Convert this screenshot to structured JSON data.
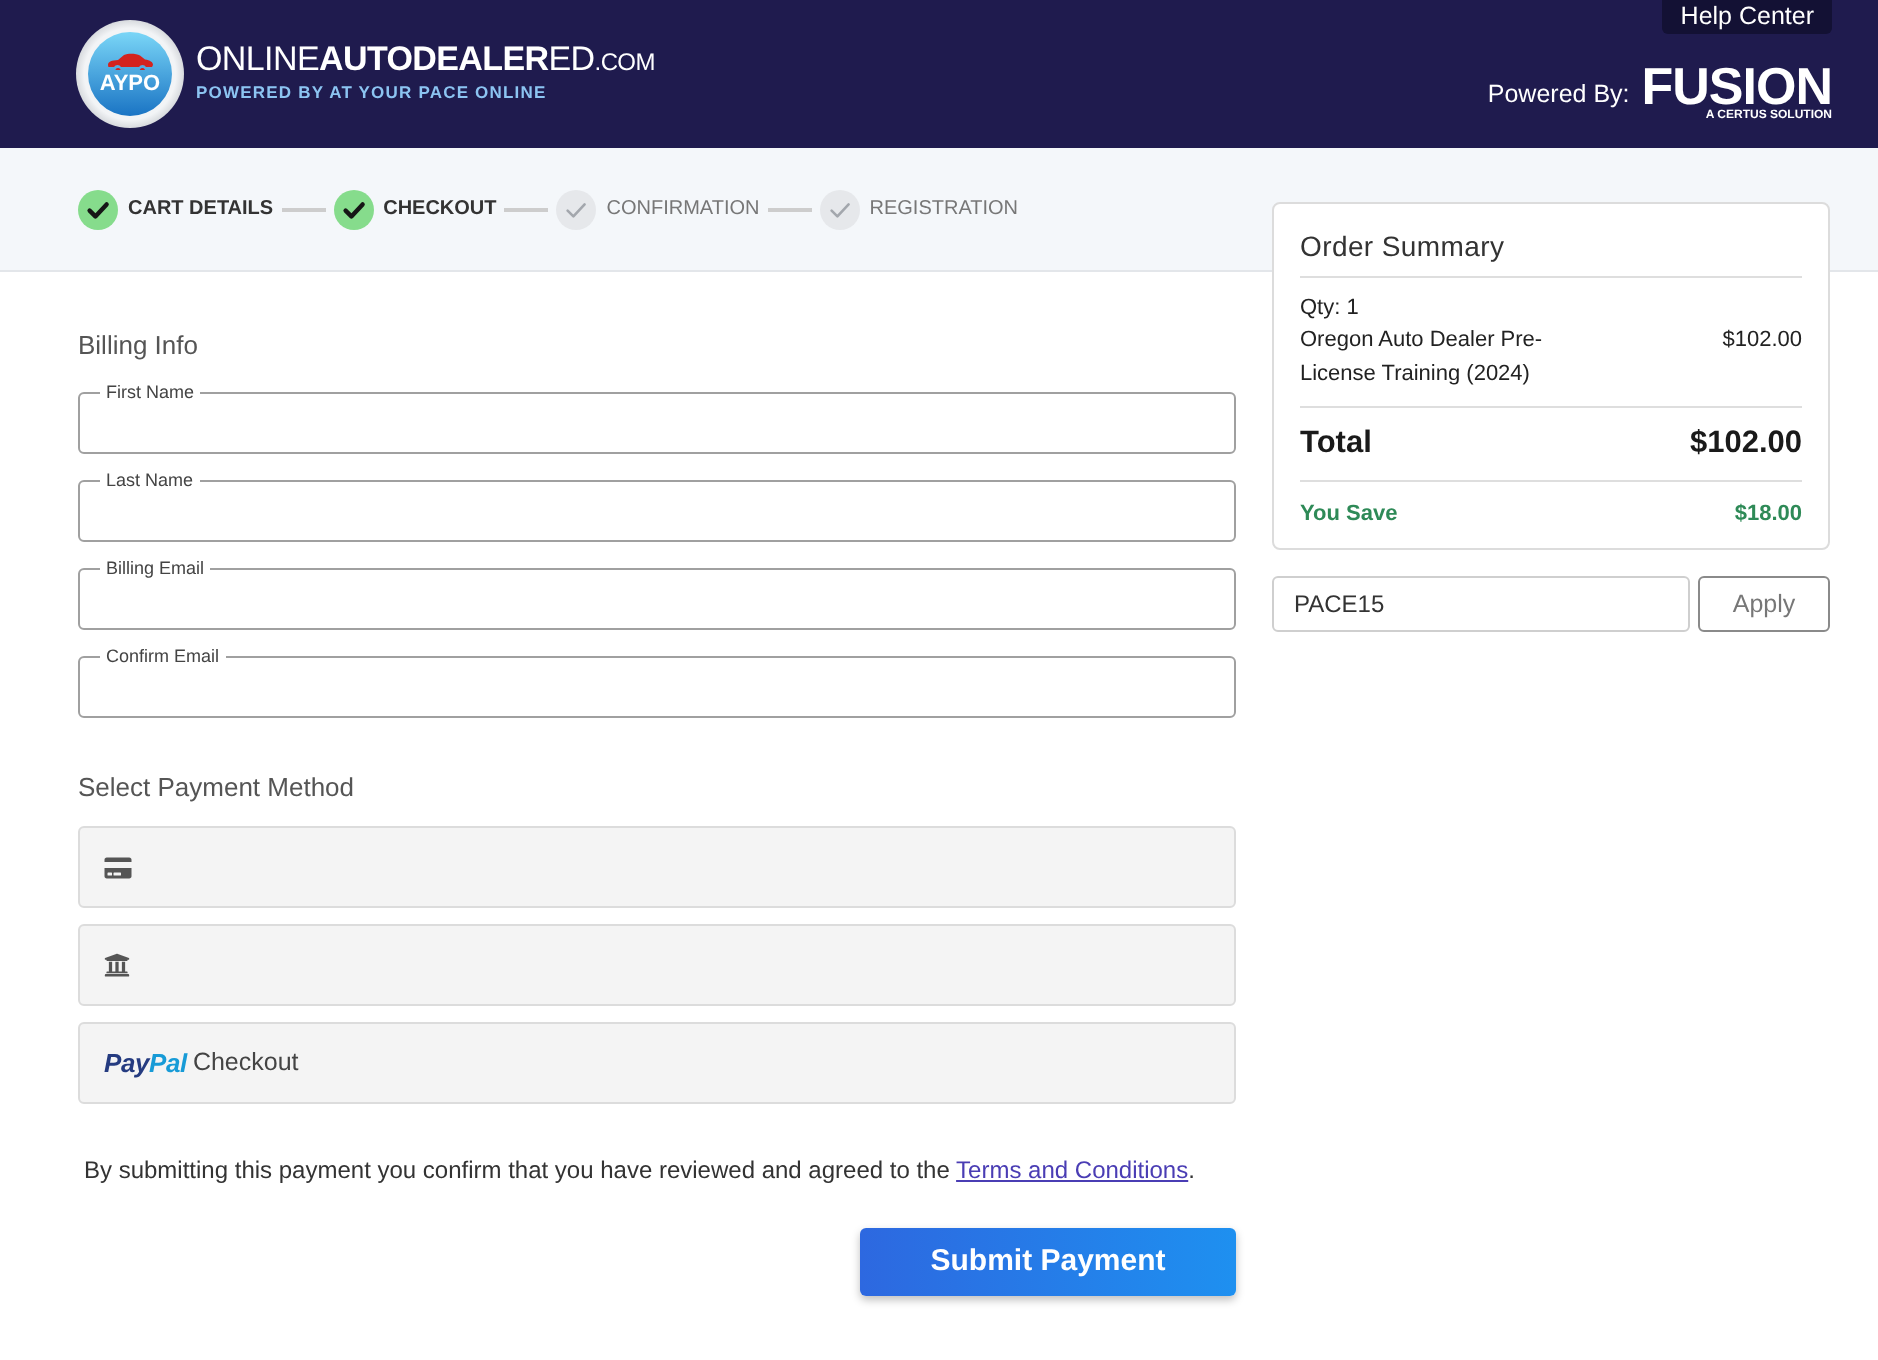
{
  "header": {
    "logo": {
      "badge": "AYPO",
      "name": "ONLINE**AUTODEALER**ED",
      "domain": ".COM",
      "tagline": "POWERED BY AT YOUR PACE ONLINE"
    },
    "help_link": "Help Center",
    "powered_by": {
      "label": "Powered By:",
      "brand": "FUSION",
      "brand_tagline": "A CERTUS SOLUTION"
    }
  },
  "steps": [
    {
      "label": "CART DETAILS",
      "completed": true
    },
    {
      "label": "CHECKOUT",
      "completed": true
    },
    {
      "label": "CONFIRMATION",
      "completed": false
    },
    {
      "label": "REGISTRATION",
      "completed": false
    }
  ],
  "billing": {
    "title": "Billing Info",
    "fields": [
      {
        "label": "First Name"
      },
      {
        "label": "Last Name"
      },
      {
        "label": "Billing Email"
      },
      {
        "label": "Confirm Email"
      }
    ]
  },
  "payment": {
    "title": "Select Payment Method",
    "options": [
      {
        "kind": "card",
        "selected": false
      },
      {
        "kind": "bank",
        "selected": false
      },
      {
        "kind": "paypal",
        "brand": [
          "Pay",
          "Pal"
        ],
        "label": "Checkout",
        "selected": false
      }
    ]
  },
  "terms": {
    "text": "By submitting this payment you confirm that you have reviewed and agreed to the",
    "link": "Terms and Conditions",
    "end": "."
  },
  "submit_button": "Submit Payment",
  "order_summary": {
    "title": "Order Summary",
    "items": [
      {
        "qty": "Qty: 1",
        "name": "Oregon Auto Dealer Pre-License Training (2024)",
        "price": "$102.00"
      }
    ],
    "total": {
      "label": "Total",
      "value": "$102.00"
    },
    "savings": {
      "label": "You Save",
      "value": "$18.00"
    }
  },
  "coupon": {
    "value": "PACE15",
    "button": "Apply"
  }
}
